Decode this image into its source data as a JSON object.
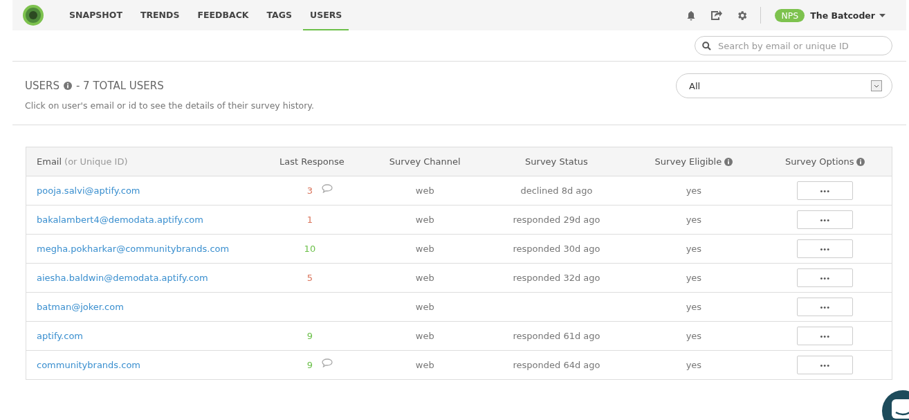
{
  "nav": {
    "tabs": [
      {
        "label": "SNAPSHOT",
        "selected": false
      },
      {
        "label": "TRENDS",
        "selected": false
      },
      {
        "label": "FEEDBACK",
        "selected": false
      },
      {
        "label": "TAGS",
        "selected": false
      },
      {
        "label": "USERS",
        "selected": true
      }
    ],
    "badge": "NPS",
    "account": "The Batcoder"
  },
  "search": {
    "placeholder": "Search by email or unique ID"
  },
  "header": {
    "title": "USERS",
    "title_suffix": "- 7 TOTAL USERS",
    "subtitle": "Click on user's email or id to see the details of their survey history.",
    "filter": "All"
  },
  "table": {
    "columns": [
      {
        "label": "Email",
        "note": "(or Unique ID)",
        "info": false
      },
      {
        "label": "Last Response",
        "info": false
      },
      {
        "label": "Survey Channel",
        "info": false
      },
      {
        "label": "Survey Status",
        "info": false
      },
      {
        "label": "Survey Eligible",
        "info": true
      },
      {
        "label": "Survey Options",
        "info": true
      }
    ],
    "rows": [
      {
        "email": "pooja.salvi@aptify.com",
        "score": "3",
        "color": "#d9735a",
        "comment": true,
        "channel": "web",
        "status": "declined 8d ago",
        "eligible": "yes",
        "options": "•••"
      },
      {
        "email": "bakalambert4@demodata.aptify.com",
        "score": "1",
        "color": "#d9735a",
        "comment": false,
        "channel": "web",
        "status": "responded 29d ago",
        "eligible": "yes",
        "options": "•••"
      },
      {
        "email": "megha.pokharkar@communitybrands.com",
        "score": "10",
        "color": "#6cc04a",
        "comment": false,
        "channel": "web",
        "status": "responded 30d ago",
        "eligible": "yes",
        "options": "•••"
      },
      {
        "email": "aiesha.baldwin@demodata.aptify.com",
        "score": "5",
        "color": "#d9735a",
        "comment": false,
        "channel": "web",
        "status": "responded 32d ago",
        "eligible": "yes",
        "options": "•••"
      },
      {
        "email": "batman@joker.com",
        "channel": "web",
        "eligible": "yes",
        "options": "•••"
      },
      {
        "email": "aptify.com",
        "score": "9",
        "color": "#6cc04a",
        "comment": false,
        "channel": "web",
        "status": "responded 61d ago",
        "eligible": "yes",
        "options": "•••"
      },
      {
        "email": "communitybrands.com",
        "score": "9",
        "color": "#6cc04a",
        "comment": true,
        "channel": "web",
        "status": "responded 64d ago",
        "eligible": "yes",
        "options": "•••"
      }
    ]
  }
}
